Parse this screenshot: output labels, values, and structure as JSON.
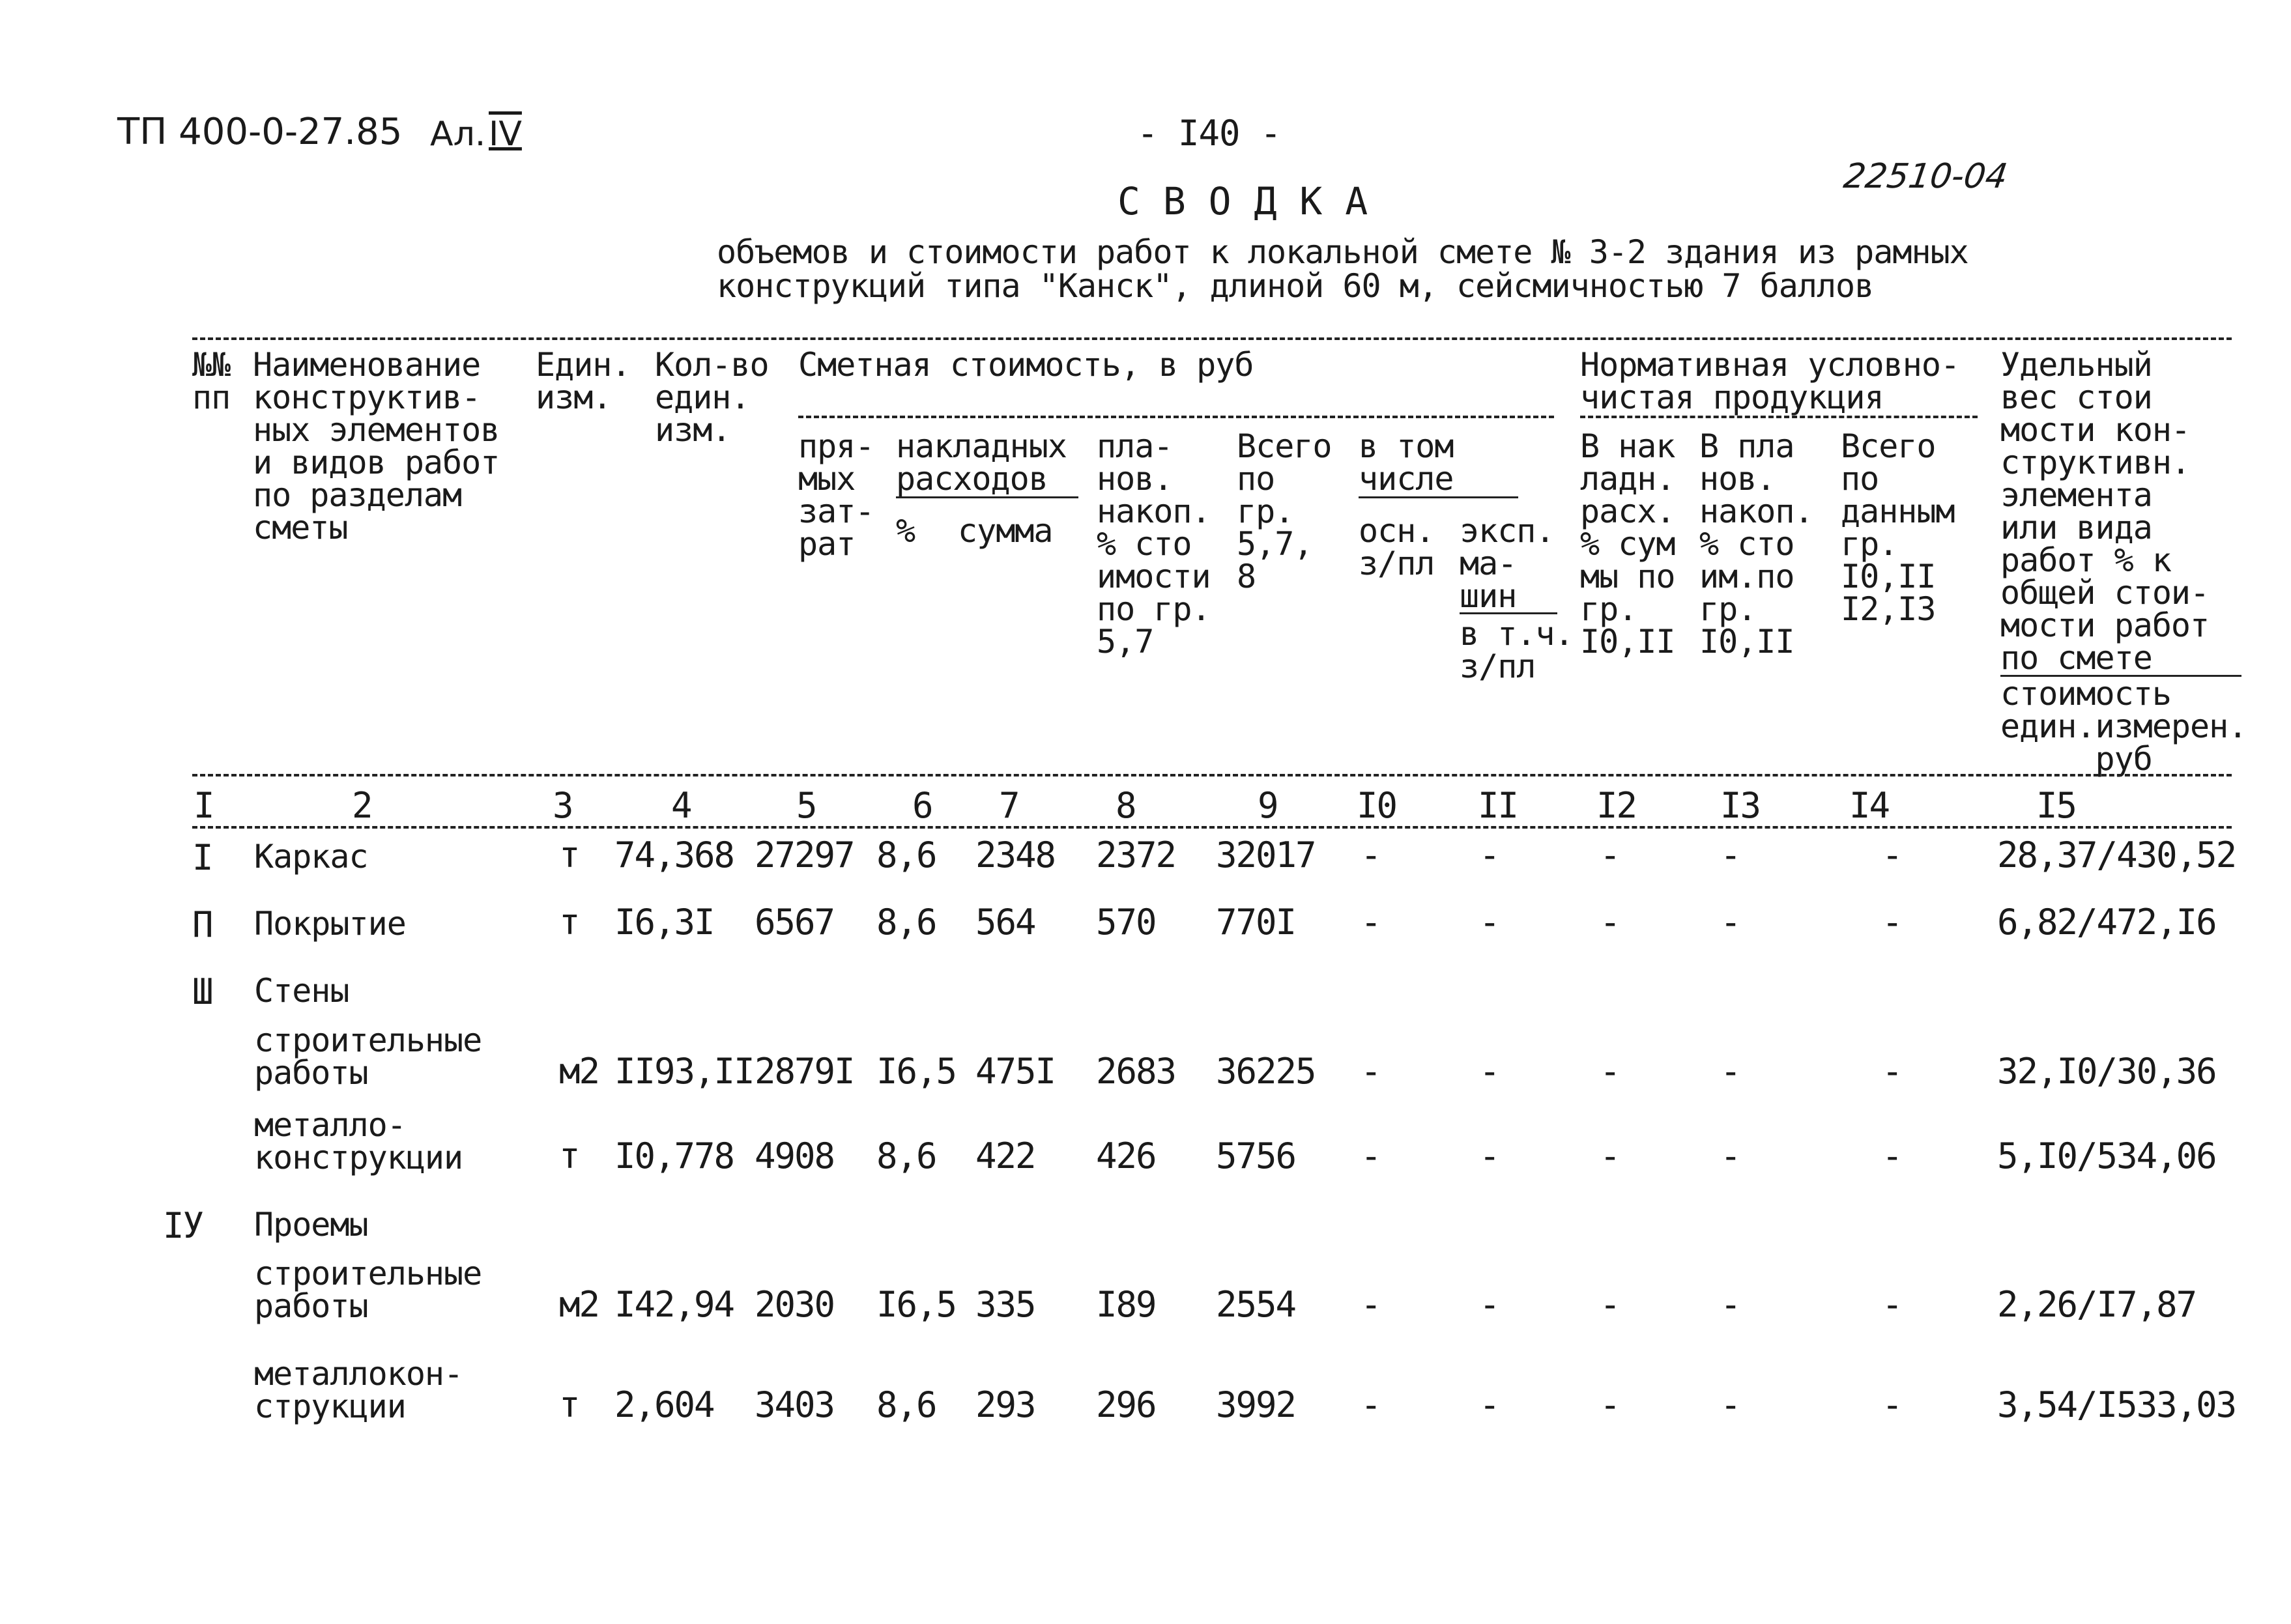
{
  "page": {
    "doc_code": "ТП 400-0-27.85",
    "album": "Ал.",
    "album_num": "IV",
    "page_number": "- I40 -",
    "stamp": "22510-04",
    "title": "С В О Д К А",
    "subtitle_line1": "объемов и стоимости работ к локальной смете № 3-2 здания из рамных",
    "subtitle_line2": "конструкций типа \"Канск\", длиной 60 м, сейсмичностью 7 баллов"
  },
  "headers": {
    "c1": "№№\nпп",
    "c2": "Наименование\nконструктив-\nных элементов\nи видов работ\nпо разделам\nсметы",
    "c3": "Един.\nизм.",
    "c4": "Кол-во\nедин.\nизм.",
    "group_cost": "Сметная стоимость, в руб",
    "c5": "пря-\nмых\nзат-\nрат",
    "overhead_group": "накладных\nрасходов",
    "c6": "%",
    "c7": "сумма",
    "c8": "пла-\nнов.\nнакоп.\n% сто\nимости\nпо гр.\n5,7",
    "c9": "Всего\nпо\nгр.\n5,7,\n8",
    "incl_group": "в том\nчисле",
    "c10": "осн.\nз/пл",
    "c11_top": "эксп.\nма-\nшин",
    "c11_bottom": "в т.ч.\nз/пл",
    "group_norm": "Нормативная условно-\nчистая продукция",
    "c12": "В нак\nладн.\nрасх.\n% сум\nмы по\nгр.\nI0,II",
    "c13": "В пла\nнов.\nнакоп.\n% сто\nим.по\nгр.\nI0,II",
    "c14": "Всего\nпо\nданным\nгр.\nI0,II\nI2,I3",
    "c15_top": "Удельный\nвес стои\nмости кон-\nструктивн.\nэлемента\nили вида\nработ % к\nобщей стои-\nмости работ\nпо смете",
    "c15_bottom": "стоимость\nедин.измерен.\n     руб"
  },
  "column_numbers": [
    "I",
    "2",
    "3",
    "4",
    "5",
    "6",
    "7",
    "8",
    "9",
    "I0",
    "II",
    "I2",
    "I3",
    "I4",
    "I5"
  ],
  "rows": [
    {
      "no": "I",
      "name": "Каркас",
      "unit": "т",
      "qty": "74,368",
      "direct": "27297",
      "oh_pct": "8,6",
      "oh_sum": "2348",
      "plan": "2372",
      "total": "32017",
      "osn": "-",
      "eksp": "-",
      "n12": "-",
      "n13": "-",
      "n14": "-",
      "share": "28,37/430,52"
    },
    {
      "no": "П",
      "name": "Покрытие",
      "unit": "т",
      "qty": "I6,3I",
      "direct": "6567",
      "oh_pct": "8,6",
      "oh_sum": "564",
      "plan": "570",
      "total": "770I",
      "osn": "-",
      "eksp": "-",
      "n12": "-",
      "n13": "-",
      "n14": "-",
      "share": "6,82/472,I6"
    },
    {
      "no": "Ш",
      "name": "Стены"
    },
    {
      "no": "",
      "name": "строительные\nработы",
      "unit": "м2",
      "qty": "II93,II",
      "direct": "2879I",
      "oh_pct": "I6,5",
      "oh_sum": "475I",
      "plan": "2683",
      "total": "36225",
      "osn": "-",
      "eksp": "-",
      "n12": "-",
      "n13": "-",
      "n14": "-",
      "share": "32,I0/30,36"
    },
    {
      "no": "",
      "name": "металло-\nконструкции",
      "unit": "т",
      "qty": "I0,778",
      "direct": "4908",
      "oh_pct": "8,6",
      "oh_sum": "422",
      "plan": "426",
      "total": "5756",
      "osn": "-",
      "eksp": "-",
      "n12": "-",
      "n13": "-",
      "n14": "-",
      "share": "5,I0/534,06"
    },
    {
      "no": "IУ",
      "name": "Проемы"
    },
    {
      "no": "",
      "name": "строительные\nработы",
      "unit": "м2",
      "qty": "I42,94",
      "direct": "2030",
      "oh_pct": "I6,5",
      "oh_sum": "335",
      "plan": "I89",
      "total": "2554",
      "osn": "-",
      "eksp": "-",
      "n12": "-",
      "n13": "-",
      "n14": "-",
      "share": "2,26/I7,87"
    },
    {
      "no": "",
      "name": "металлокон-\nструкции",
      "unit": "т",
      "qty": "2,604",
      "direct": "3403",
      "oh_pct": "8,6",
      "oh_sum": "293",
      "plan": "296",
      "total": "3992",
      "osn": "-",
      "eksp": "-",
      "n12": "-",
      "n13": "-",
      "n14": "-",
      "share": "3,54/I533,03"
    }
  ]
}
